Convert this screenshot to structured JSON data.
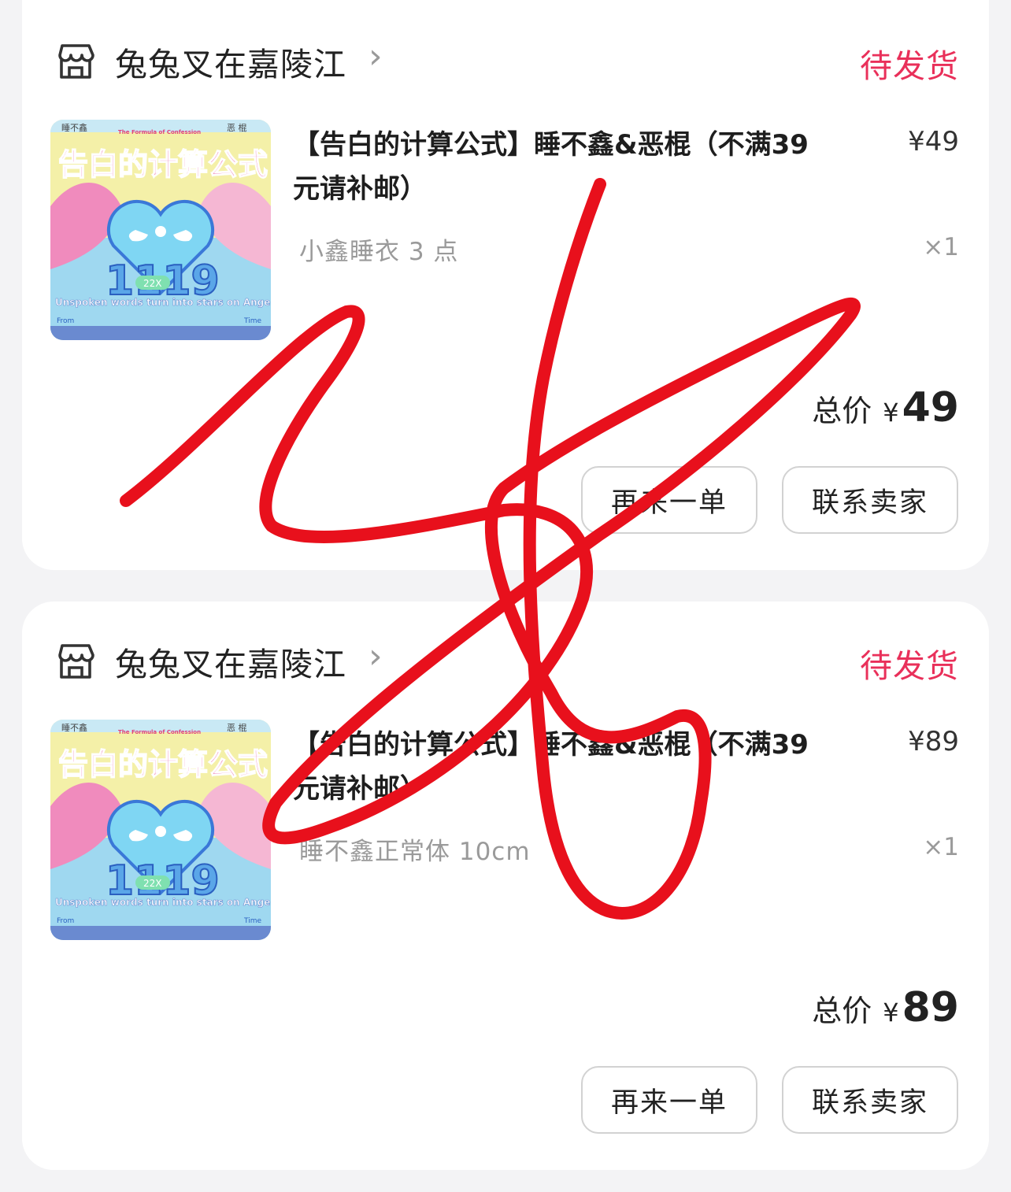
{
  "orders": [
    {
      "shop_name": "兔兔叉在嘉陵江",
      "status": "待发货",
      "product": {
        "title": "【告白的计算公式】睡不鑫&恶棍（不满39元请补邮）",
        "price": "¥49",
        "spec": "小鑫睡衣 3 点",
        "quantity": "×1",
        "image_texts": {
          "left_name": "睡不鑫",
          "right_name": "恶 棍",
          "subtitle": "The Formula of Confession",
          "title": "告白的计算公式",
          "date": "1119",
          "tag": "22X",
          "tagline": "Unspoken words turn into stars on Angel wings.",
          "from": "From",
          "time": "Time"
        }
      },
      "total": {
        "label": "总价",
        "currency": "¥",
        "amount": "49"
      },
      "actions": {
        "reorder": "再来一单",
        "contact": "联系卖家"
      }
    },
    {
      "shop_name": "兔兔叉在嘉陵江",
      "status": "待发货",
      "product": {
        "title": "【告白的计算公式】睡不鑫&恶棍（不满39元请补邮）",
        "price": "¥89",
        "spec": "睡不鑫正常体 10cm",
        "quantity": "×1",
        "image_texts": {
          "left_name": "睡不鑫",
          "right_name": "恶 棍",
          "subtitle": "The Formula of Confession",
          "title": "告白的计算公式",
          "date": "1119",
          "tag": "22X",
          "tagline": "Unspoken words turn into stars on Angel wings.",
          "from": "From",
          "time": "Time"
        }
      },
      "total": {
        "label": "总价",
        "currency": "¥",
        "amount": "89"
      },
      "actions": {
        "reorder": "再来一单",
        "contact": "联系卖家"
      }
    }
  ],
  "colors": {
    "status": "#e9305a",
    "scribble": "#e8101c",
    "background": "#f3f3f5"
  },
  "icons": {
    "shop": "storefront-icon",
    "chevron": "chevron-right-icon"
  }
}
